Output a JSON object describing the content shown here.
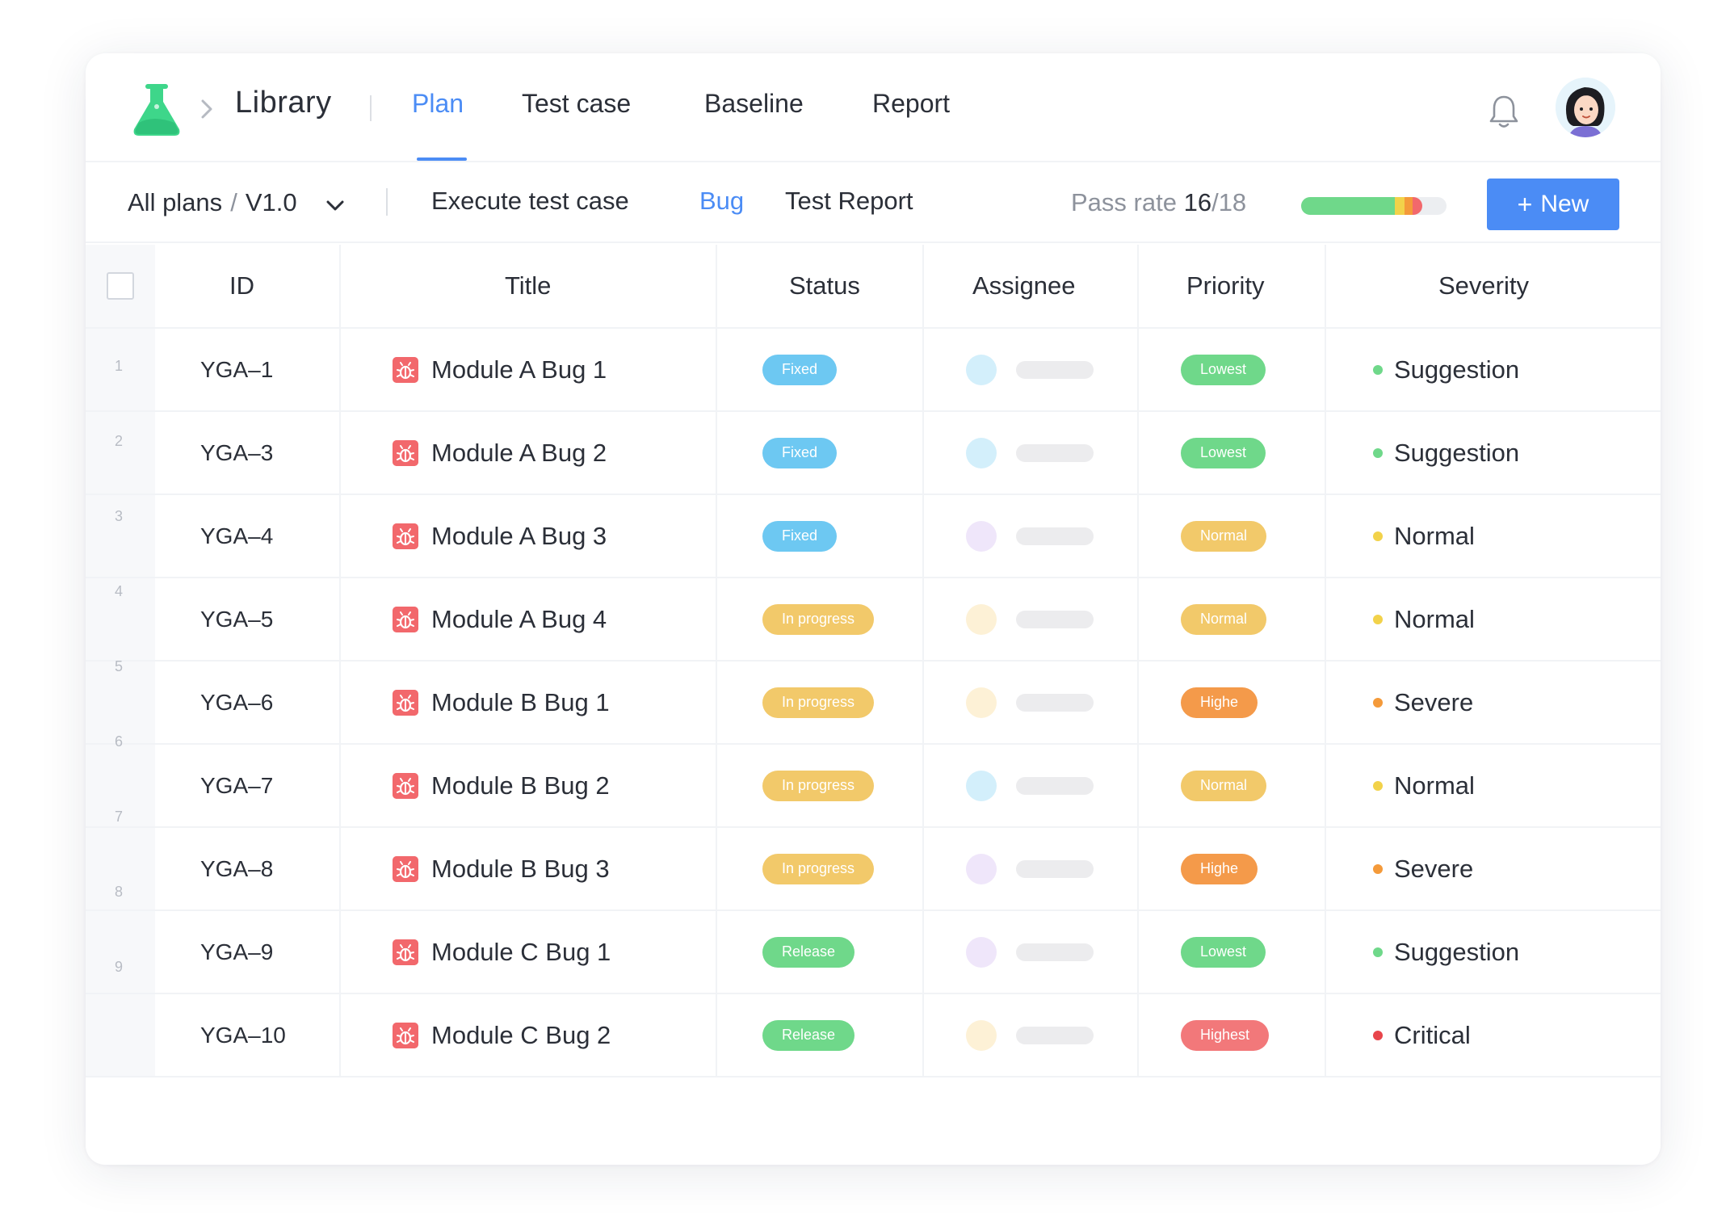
{
  "app": {
    "title": "Library"
  },
  "nav": {
    "tabs": [
      {
        "label": "Plan",
        "active": true
      },
      {
        "label": "Test case",
        "active": false
      },
      {
        "label": "Baseline",
        "active": false
      },
      {
        "label": "Report",
        "active": false
      }
    ]
  },
  "toolbar": {
    "plan_selector": {
      "scope": "All plans",
      "version": "V1.0"
    },
    "tabs": [
      {
        "label": "Execute test case",
        "active": false
      },
      {
        "label": "Bug",
        "active": true
      },
      {
        "label": "Test Report",
        "active": false
      }
    ],
    "pass_rate": {
      "label": "Pass rate",
      "passed": "16",
      "total": "18"
    },
    "new_button": {
      "label": "New"
    }
  },
  "table": {
    "columns": [
      "ID",
      "Title",
      "Status",
      "Assignee",
      "Priority",
      "Severity"
    ],
    "row_numbers": [
      "1",
      "2",
      "3",
      "4",
      "5",
      "6",
      "7",
      "8",
      "9"
    ],
    "rows": [
      {
        "id": "YGA–1",
        "title": "Module A Bug 1",
        "status": "Fixed",
        "status_kind": "fixed",
        "assignee_color": "#d3effb",
        "priority": "Lowest",
        "priority_kind": "lowest",
        "severity": "Suggestion",
        "severity_color": "#6fd88a"
      },
      {
        "id": "YGA–3",
        "title": "Module A Bug 2",
        "status": "Fixed",
        "status_kind": "fixed",
        "assignee_color": "#d3effb",
        "priority": "Lowest",
        "priority_kind": "lowest",
        "severity": "Suggestion",
        "severity_color": "#6fd88a"
      },
      {
        "id": "YGA–4",
        "title": "Module A Bug 3",
        "status": "Fixed",
        "status_kind": "fixed",
        "assignee_color": "#efe6fa",
        "priority": "Normal",
        "priority_kind": "normal",
        "severity": "Normal",
        "severity_color": "#f2d24a"
      },
      {
        "id": "YGA–5",
        "title": "Module A Bug 4",
        "status": "In progress",
        "status_kind": "progress-pill",
        "assignee_color": "#fdf1d6",
        "priority": "Normal",
        "priority_kind": "normal",
        "severity": "Normal",
        "severity_color": "#f2d24a"
      },
      {
        "id": "YGA–6",
        "title": "Module B Bug 1",
        "status": "In progress",
        "status_kind": "progress-pill",
        "assignee_color": "#fdf1d6",
        "priority": "Highe",
        "priority_kind": "high",
        "severity": "Severe",
        "severity_color": "#f49a3a"
      },
      {
        "id": "YGA–7",
        "title": "Module B Bug 2",
        "status": "In progress",
        "status_kind": "progress-pill",
        "assignee_color": "#d3effb",
        "priority": "Normal",
        "priority_kind": "normal",
        "severity": "Normal",
        "severity_color": "#f2d24a"
      },
      {
        "id": "YGA–8",
        "title": "Module B Bug 3",
        "status": "In progress",
        "status_kind": "progress-pill",
        "assignee_color": "#efe6fa",
        "priority": "Highe",
        "priority_kind": "high",
        "severity": "Severe",
        "severity_color": "#f49a3a"
      },
      {
        "id": "YGA–9",
        "title": "Module C Bug 1",
        "status": "Release",
        "status_kind": "release",
        "assignee_color": "#efe6fa",
        "priority": "Lowest",
        "priority_kind": "lowest",
        "severity": "Suggestion",
        "severity_color": "#6fd88a"
      },
      {
        "id": "YGA–10",
        "title": "Module C Bug 2",
        "status": "Release",
        "status_kind": "release",
        "assignee_color": "#fdf1d6",
        "priority": "Highest",
        "priority_kind": "highest",
        "severity": "Critical",
        "severity_color": "#e8454b"
      }
    ]
  },
  "colors": {
    "accent": "#4b8cf5",
    "brand_green": "#3ed68a",
    "bug_icon": "#f2686c"
  },
  "icons": {
    "logo": "flask-logo-icon",
    "bell": "bell-icon",
    "chevron": "chevron-down-icon",
    "bug": "bug-icon"
  }
}
